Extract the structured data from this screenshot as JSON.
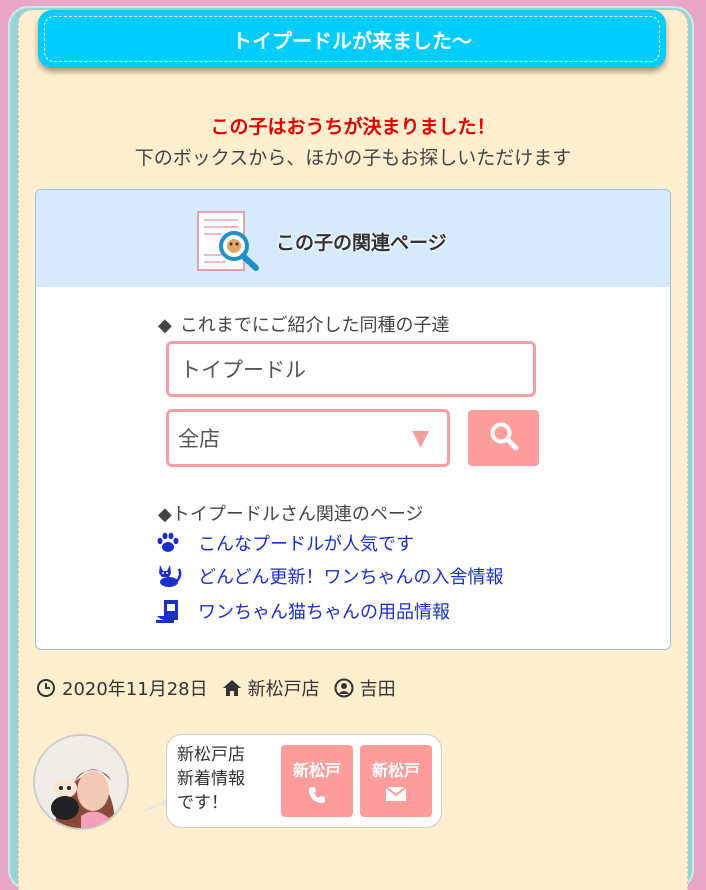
{
  "header": {
    "title": "トイプードルが来ました～"
  },
  "notice": {
    "decided": "この子はおうちが決まりました！",
    "sub": "下のボックスから、ほかの子もお探しいただけます"
  },
  "related": {
    "title": "この子の関連ページ",
    "search": {
      "label": "これまでにご紹介した同種の子達",
      "breed_value": "トイプードル",
      "store_value": "全店",
      "arrow": "▼"
    },
    "pages_label": "トイプードルさん関連のページ",
    "diamond": "◆",
    "links": [
      {
        "icon": "paw-icon",
        "label": "こんなプードルが人気です"
      },
      {
        "icon": "cat-icon",
        "label": "どんどん更新！ワンちゃんの入舎情報"
      },
      {
        "icon": "pet-food-icon",
        "label": "ワンちゃん猫ちゃんの用品情報"
      }
    ]
  },
  "meta": {
    "date": "2020年11月28日",
    "store": "新松戸店",
    "author": "吉田"
  },
  "store_card": {
    "bubble_lines": [
      "新松戸店",
      "新着情報",
      "です！"
    ],
    "phone_label": "新松戸",
    "mail_label": "新松戸"
  },
  "colors": {
    "accent": "#00ccff",
    "pink": "#ff9c9c",
    "link": "#1a2fc9",
    "alert": "#e00000"
  }
}
